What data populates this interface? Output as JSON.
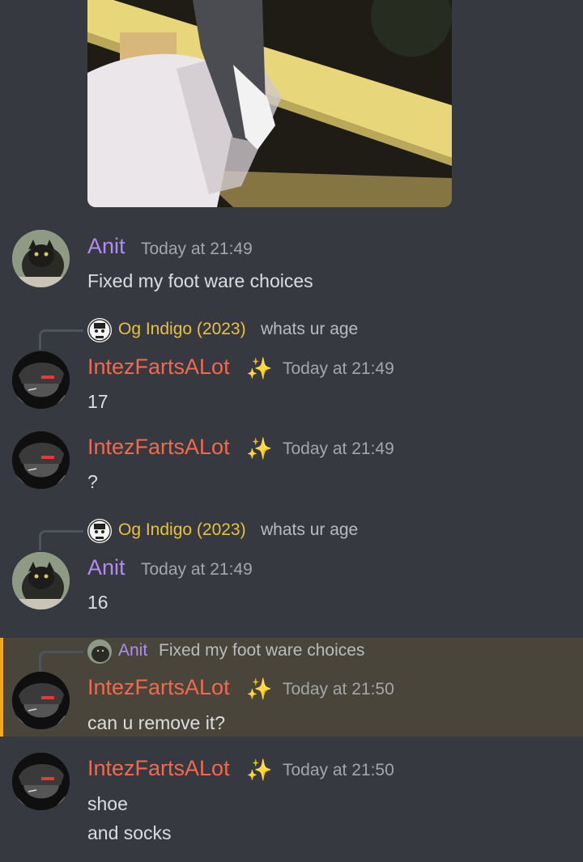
{
  "attachment": {
    "description_icon": "photo-attachment-icon"
  },
  "messages": [
    {
      "author": "Anit",
      "time": "Today at 21:49",
      "lines": [
        "Fixed my foot ware choices"
      ]
    },
    {
      "reply_to": {
        "author": "Og Indigo (2023)",
        "text": "whats ur age"
      },
      "author": "IntezFartsALot",
      "badge": "✨",
      "time": "Today at 21:49",
      "lines": [
        "17"
      ]
    },
    {
      "author": "IntezFartsALot",
      "badge": "✨",
      "time": "Today at 21:49",
      "lines": [
        "?"
      ]
    },
    {
      "reply_to": {
        "author": "Og Indigo (2023)",
        "text": "whats ur age"
      },
      "author": "Anit",
      "time": "Today at 21:49",
      "lines": [
        "16"
      ]
    },
    {
      "reply_to": {
        "author": "Anit",
        "text": "Fixed my foot ware choices"
      },
      "author": "IntezFartsALot",
      "badge": "✨",
      "time": "Today at 21:50",
      "lines": [
        "can u remove it?"
      ],
      "highlighted": true
    },
    {
      "author": "IntezFartsALot",
      "badge": "✨",
      "time": "Today at 21:50",
      "lines": [
        "shoe",
        "and socks"
      ]
    }
  ],
  "colors": {
    "background": "#36393f",
    "anit": "#b08cf0",
    "intez": "#f06a4f",
    "indigo": "#e8c23c",
    "highlight_bar": "#faa61a"
  }
}
